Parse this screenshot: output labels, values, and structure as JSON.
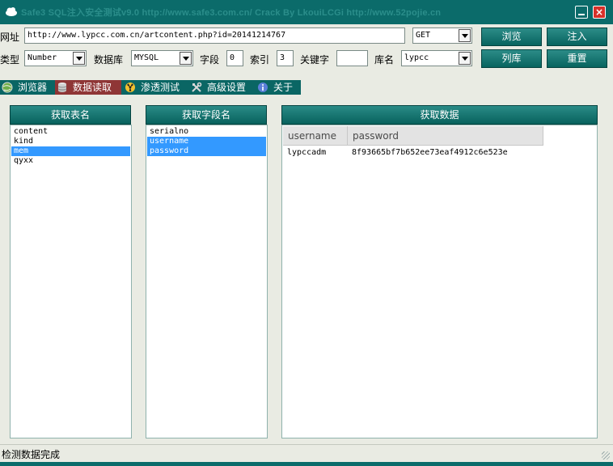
{
  "window": {
    "title": "Safe3 SQL注入安全测试v9.0  http://www.safe3.com.cn/       Crack  By  LkouiLCGi      http://www.52pojie.cn",
    "minimize_label": "",
    "close_label": "×"
  },
  "toolbar": {
    "url_label": "网址",
    "url_value": "http://www.lypcc.com.cn/artcontent.php?id=20141214767",
    "method": "GET",
    "type_label": "类型",
    "type_value": "Number",
    "db_label": "数据库",
    "db_value": "MYSQL",
    "field_label": "字段",
    "field_value": "0",
    "index_label": "索引",
    "index_value": "3",
    "keyword_label": "关键字",
    "keyword_value": "",
    "dbname_label": "库名",
    "dbname_value": "lypcc",
    "browse_label": "浏览",
    "inject_label": "注入",
    "listdb_label": "列库",
    "reset_label": "重置"
  },
  "tabs": [
    {
      "label": "浏览器",
      "icon": "globe-icon",
      "active": false
    },
    {
      "label": "数据读取",
      "icon": "database-icon",
      "active": true
    },
    {
      "label": "渗透测试",
      "icon": "radiation-icon",
      "active": false
    },
    {
      "label": "高级设置",
      "icon": "tools-icon",
      "active": false
    },
    {
      "label": "关于",
      "icon": "info-icon",
      "active": false
    }
  ],
  "tables_panel": {
    "header": "获取表名",
    "items": [
      "content",
      "kind",
      "mem",
      "qyxx"
    ],
    "selected": 2
  },
  "fields_panel": {
    "header": "获取字段名",
    "items": [
      "serialno",
      "username",
      "password"
    ],
    "selected": [
      1,
      2
    ]
  },
  "data_panel": {
    "header": "获取数据",
    "columns": [
      "username",
      "password"
    ],
    "rows": [
      [
        "lypccadm",
        "8f93665bf7b652ee73eaf4912c6e523e"
      ]
    ]
  },
  "status": {
    "text": "检测数据完成"
  },
  "colors": {
    "teal": "#0b6b6a",
    "active_tab": "#8f3636",
    "selection": "#3399ff"
  }
}
